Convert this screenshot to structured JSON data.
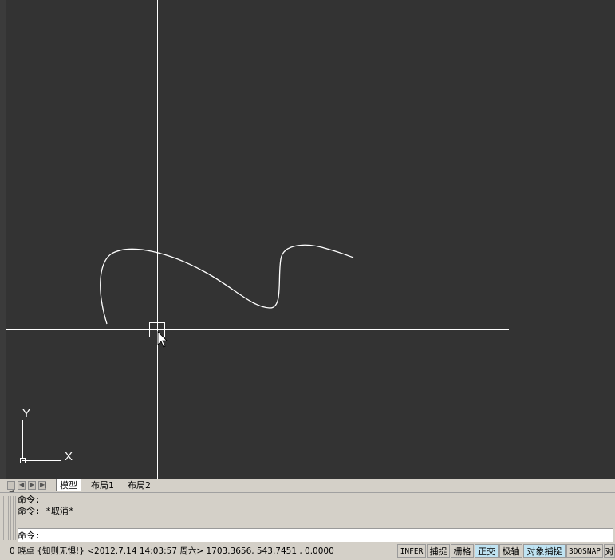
{
  "tabs": [
    {
      "label": "模型",
      "active": true
    },
    {
      "label": "布局1",
      "active": false
    },
    {
      "label": "布局2",
      "active": false
    }
  ],
  "ucs": {
    "x_label": "X",
    "y_label": "Y"
  },
  "command": {
    "history": [
      "命令:",
      "命令: *取消*"
    ],
    "prompt": "命令:"
  },
  "status": {
    "text": "0 晓卓 {知则无惧!} <2012.7.14  14:03:57 周六>  1703.3656, 543.7451  , 0.0000"
  },
  "status_buttons": [
    {
      "label": "INFER",
      "on": false
    },
    {
      "label": "捕捉",
      "on": false
    },
    {
      "label": "栅格",
      "on": false
    },
    {
      "label": "正交",
      "on": true
    },
    {
      "label": "极轴",
      "on": false
    },
    {
      "label": "对象捕捉",
      "on": true
    },
    {
      "label": "3DOSNAP",
      "on": false
    },
    {
      "label": "对",
      "on": false
    }
  ],
  "colors": {
    "canvas": "#333333",
    "crosshair": "#ffffff",
    "on_button": "#bfe3f2"
  }
}
